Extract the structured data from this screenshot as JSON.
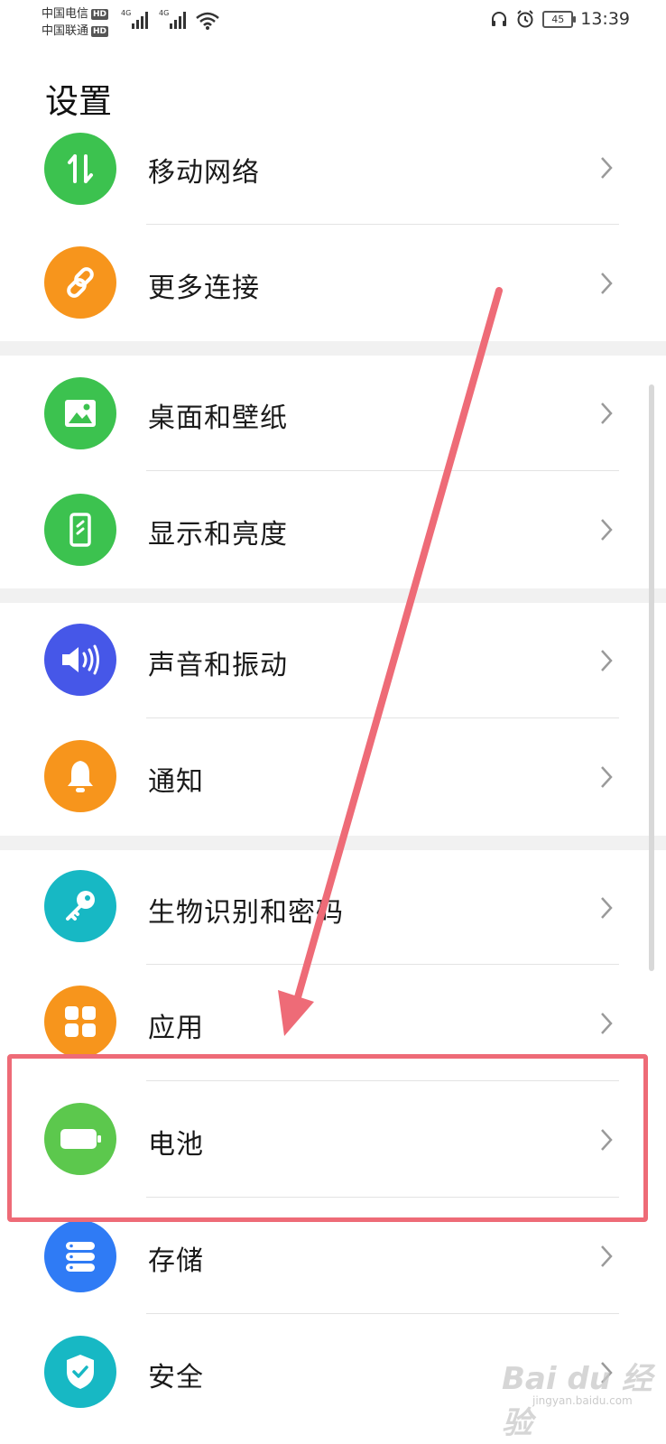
{
  "status_bar": {
    "carrier_1": "中国电信",
    "carrier_2": "中国联通",
    "hd_badge": "HD",
    "network_type": "4G",
    "battery_level": "45",
    "time": "13:39"
  },
  "page": {
    "title": "设置"
  },
  "settings_items": [
    {
      "label": "移动网络",
      "icon": "mobile-network-icon",
      "color": "#3cc24f"
    },
    {
      "label": "更多连接",
      "icon": "link-icon",
      "color": "#f7951c"
    },
    {
      "label": "桌面和壁纸",
      "icon": "wallpaper-icon",
      "color": "#3cc24f"
    },
    {
      "label": "显示和亮度",
      "icon": "display-brightness-icon",
      "color": "#3cc24f"
    },
    {
      "label": "声音和振动",
      "icon": "speaker-icon",
      "color": "#4657e8"
    },
    {
      "label": "通知",
      "icon": "bell-icon",
      "color": "#f7951c"
    },
    {
      "label": "生物识别和密码",
      "icon": "key-icon",
      "color": "#17b8c4"
    },
    {
      "label": "应用",
      "icon": "apps-grid-icon",
      "color": "#f7951c"
    },
    {
      "label": "电池",
      "icon": "battery-icon",
      "color": "#5cc84d"
    },
    {
      "label": "存储",
      "icon": "storage-icon",
      "color": "#2f7bf5"
    },
    {
      "label": "安全",
      "icon": "shield-check-icon",
      "color": "#17b8c4"
    }
  ],
  "watermark": {
    "text": "Bai du 经验",
    "sub": "jingyan.baidu.com"
  },
  "annotation": {
    "highlight_color": "#ee6b77"
  }
}
